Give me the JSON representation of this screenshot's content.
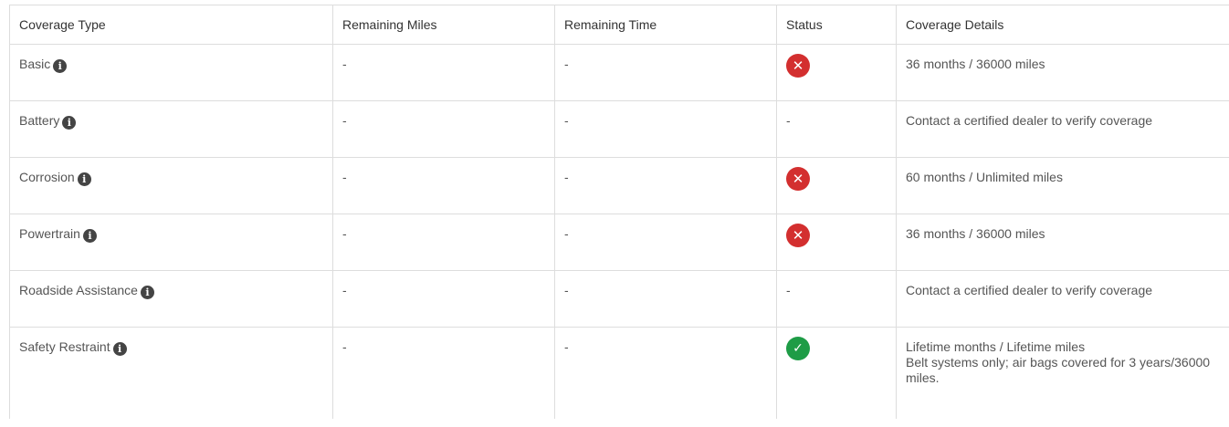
{
  "table": {
    "headers": {
      "coverage_type": "Coverage Type",
      "remaining_miles": "Remaining Miles",
      "remaining_time": "Remaining Time",
      "status": "Status",
      "coverage_details": "Coverage Details"
    },
    "rows": [
      {
        "type": "Basic",
        "miles": "-",
        "time": "-",
        "status": "expired",
        "status_icon": "x-circle-icon",
        "details": [
          "36 months / 36000 miles"
        ]
      },
      {
        "type": "Battery",
        "miles": "-",
        "time": "-",
        "status": "-",
        "status_icon": "",
        "details": [
          "Contact a certified dealer to verify coverage"
        ]
      },
      {
        "type": "Corrosion",
        "miles": "-",
        "time": "-",
        "status": "expired",
        "status_icon": "x-circle-icon",
        "details": [
          "60 months / Unlimited miles"
        ]
      },
      {
        "type": "Powertrain",
        "miles": "-",
        "time": "-",
        "status": "expired",
        "status_icon": "x-circle-icon",
        "details": [
          "36 months / 36000 miles"
        ]
      },
      {
        "type": "Roadside Assistance",
        "miles": "-",
        "time": "-",
        "status": "-",
        "status_icon": "",
        "details": [
          "Contact a certified dealer to verify coverage"
        ]
      },
      {
        "type": "Safety Restraint",
        "miles": "-",
        "time": "-",
        "status": "active",
        "status_icon": "check-circle-icon",
        "details": [
          "Lifetime months / Lifetime miles",
          "Belt systems only; air bags covered for 3 years/36000 miles."
        ]
      }
    ]
  },
  "icons": {
    "info": "info-icon",
    "expired": "x-circle-icon",
    "active": "check-circle-icon"
  },
  "colors": {
    "expired": "#d32f2f",
    "active": "#1e9c46",
    "info": "#444444",
    "border": "#dddddd"
  }
}
